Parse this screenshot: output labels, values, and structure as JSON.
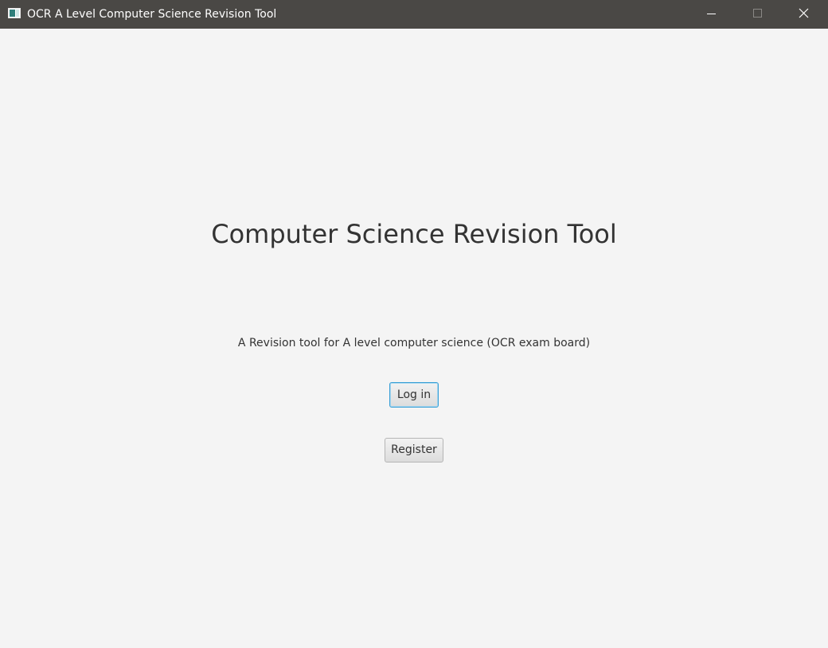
{
  "window": {
    "title": "OCR A Level Computer Science Revision Tool"
  },
  "titlebar_controls": {
    "minimize_icon": "minimize-icon",
    "maximize_icon": "maximize-icon",
    "close_icon": "close-icon"
  },
  "main": {
    "heading": "Computer Science Revision Tool",
    "subtitle": "A Revision tool for A level computer science (OCR exam board)",
    "login_label": "Log in",
    "register_label": "Register"
  },
  "colors": {
    "titlebar": "#4a4845",
    "background": "#f4f4f4",
    "focus_border": "#3aa0d6"
  }
}
